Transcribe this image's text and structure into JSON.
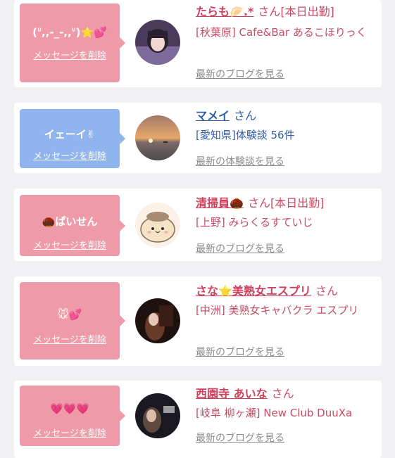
{
  "entries": [
    {
      "bubble_msg": "(ᐡ,,-_-,,ᐡ)⭐💕",
      "delete_label": "メッセージを削除",
      "name": "たらも🥟.*",
      "suffix": "さん[本日出勤]",
      "shop": "[秋葉原] Cafe&Bar あるこほりっく",
      "link": "最新のブログを見る"
    },
    {
      "bubble_msg": "イェーイ✌",
      "delete_label": "メッセージを削除",
      "name": "マメイ",
      "suffix": "さん",
      "shop": "[愛知県]体験談 56件",
      "link": "最新の体験談を見る"
    },
    {
      "bubble_msg": "🌰ぱいせん",
      "delete_label": "メッセージを削除",
      "name": "清掃員🌰",
      "suffix": "さん[本日出勤]",
      "shop": "[上野] みらくるすていじ",
      "link": "最新のブログを見る"
    },
    {
      "bubble_msg": "🐭💕",
      "delete_label": "メッセージを削除",
      "name": "さな⭐美熟女エスプリ",
      "suffix": "さん",
      "shop": "[中洲] 美熟女キャバクラ エスプリ",
      "link": "最新のブログを見る"
    },
    {
      "bubble_msg": "💗💗💗",
      "delete_label": "メッセージを削除",
      "name": "西園寺 あいな",
      "suffix": "さん",
      "shop": "[岐阜 柳ヶ瀬] New Club DuuXa",
      "link": "最新のブログを見る"
    }
  ],
  "colors": {
    "pink_bubble": "#ee9aa9",
    "blue_bubble": "#8fb4ee",
    "name_pink": "#d23f5c",
    "name_blue": "#2e5da8"
  }
}
